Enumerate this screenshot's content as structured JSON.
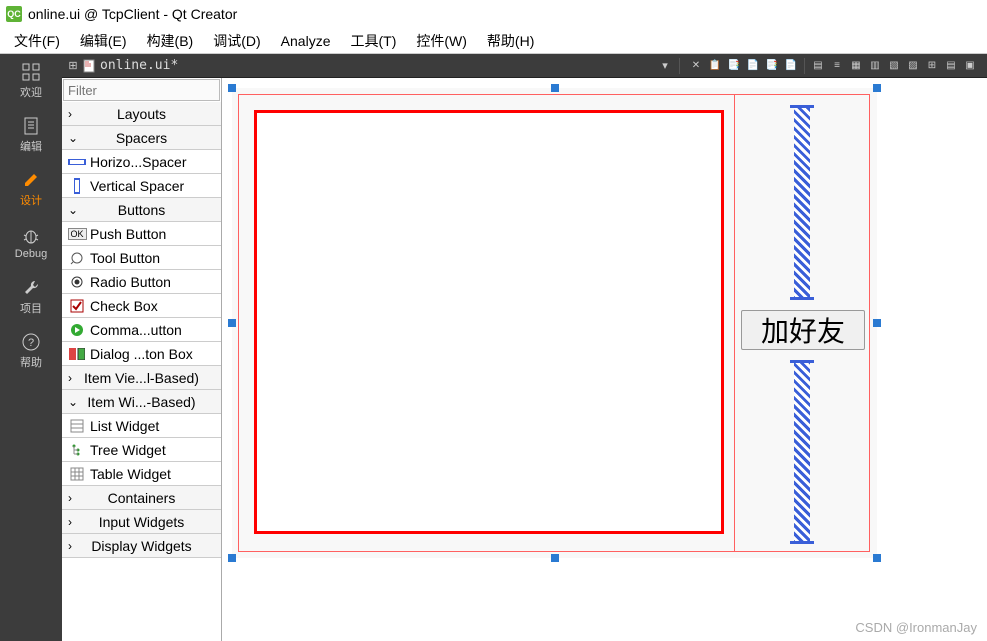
{
  "title": "online.ui @ TcpClient - Qt Creator",
  "menu": [
    "文件(F)",
    "编辑(E)",
    "构建(B)",
    "调试(D)",
    "Analyze",
    "工具(T)",
    "控件(W)",
    "帮助(H)"
  ],
  "activity": [
    {
      "id": "welcome",
      "label": "欢迎",
      "icon": "grid"
    },
    {
      "id": "edit",
      "label": "编辑",
      "icon": "doc"
    },
    {
      "id": "design",
      "label": "设计",
      "icon": "pencil",
      "active": true
    },
    {
      "id": "debug",
      "label": "Debug",
      "icon": "bug"
    },
    {
      "id": "project",
      "label": "项目",
      "icon": "wrench"
    },
    {
      "id": "help",
      "label": "帮助",
      "icon": "question"
    }
  ],
  "doc_tab": {
    "filename": "online.ui*",
    "dropdown": "▾"
  },
  "toolbar_icons": [
    "✕",
    "📋",
    "📑",
    "📄",
    "📑",
    "📄",
    "|",
    "▤",
    "≡",
    "▦",
    "▥",
    "▧",
    "▨",
    "⊞",
    "▤",
    "▣"
  ],
  "widget_box": {
    "filter_placeholder": "Filter",
    "groups": [
      {
        "type": "header",
        "label": "Layouts",
        "expanded": false
      },
      {
        "type": "header",
        "label": "Spacers",
        "expanded": true
      },
      {
        "type": "leaf",
        "icon": "hspacer",
        "label": "Horizo...Spacer"
      },
      {
        "type": "leaf",
        "icon": "vspacer",
        "label": "Vertical Spacer"
      },
      {
        "type": "header",
        "label": "Buttons",
        "expanded": true
      },
      {
        "type": "leaf",
        "icon": "ok",
        "label": "Push Button"
      },
      {
        "type": "leaf",
        "icon": "tool",
        "label": "Tool Button"
      },
      {
        "type": "leaf",
        "icon": "radio",
        "label": "Radio Button"
      },
      {
        "type": "leaf",
        "icon": "check",
        "label": "Check Box"
      },
      {
        "type": "leaf",
        "icon": "cmd",
        "label": "Comma...utton"
      },
      {
        "type": "leaf",
        "icon": "dlg",
        "label": "Dialog ...ton Box"
      },
      {
        "type": "header",
        "label": "Item Vie...l-Based)",
        "expanded": false
      },
      {
        "type": "header",
        "label": "Item Wi...-Based)",
        "expanded": true
      },
      {
        "type": "leaf",
        "icon": "list",
        "label": "List Widget"
      },
      {
        "type": "leaf",
        "icon": "tree",
        "label": "Tree Widget"
      },
      {
        "type": "leaf",
        "icon": "table",
        "label": "Table Widget"
      },
      {
        "type": "header",
        "label": "Containers",
        "expanded": false
      },
      {
        "type": "header",
        "label": "Input Widgets",
        "expanded": false
      },
      {
        "type": "header",
        "label": "Display Widgets",
        "expanded": false
      }
    ]
  },
  "canvas": {
    "button_label": "加好友"
  },
  "watermark": "CSDN @IronmanJay"
}
